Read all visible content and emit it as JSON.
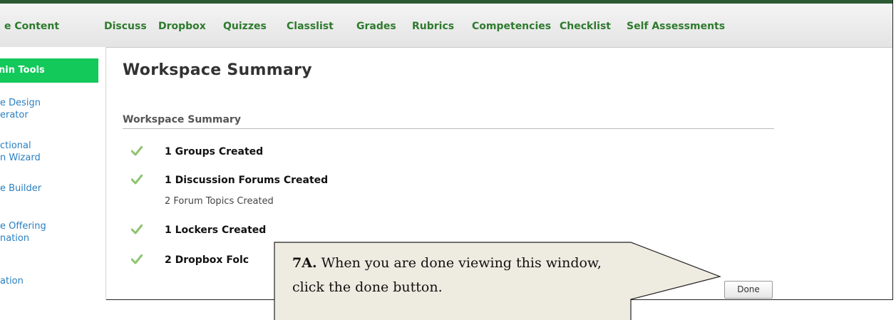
{
  "navbar": {
    "items": [
      "e Content",
      "Discuss",
      "Dropbox",
      "Quizzes",
      "Classlist",
      "Grades",
      "Rubrics",
      "Competencies",
      "Checklist",
      "Self Assessments"
    ],
    "accent": "#2e7a2e"
  },
  "left_nav": {
    "header": "nin Tools",
    "links": [
      "e Design\nerator",
      "ctional\nn Wizard",
      "e Builder",
      "e Offering\nnation",
      "ation"
    ],
    "header_color": "#12c95a"
  },
  "main": {
    "page_title": "Workspace Summary",
    "section_title": "Workspace Summary",
    "items": [
      {
        "label": "1 Groups Created",
        "sub": ""
      },
      {
        "label": "1 Discussion Forums Created",
        "sub": "2 Forum Topics Created"
      },
      {
        "label": "1 Lockers Created",
        "sub": ""
      },
      {
        "label": "2 Dropbox Folc",
        "sub": ""
      }
    ],
    "done_label": "Done",
    "check_icon": "checkmark-icon"
  },
  "callout": {
    "step": "7A.",
    "text": " When you are done viewing this window, click the done button.",
    "fill": "#eeebe0"
  }
}
